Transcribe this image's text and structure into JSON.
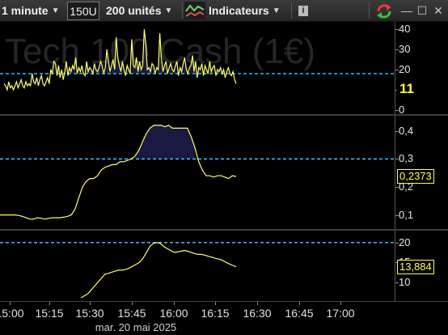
{
  "toolbar": {
    "interval": "1 minute",
    "units_box": "150U",
    "units_count": "200 unités",
    "indicators": "Indicateurs"
  },
  "instrument_title": "Tech 100 Cash (1€)",
  "panels": [
    {
      "id": "volume",
      "ticks": [
        "40",
        "30",
        "20",
        "10",
        "0"
      ],
      "tick_values": [
        40,
        30,
        20,
        10,
        0
      ],
      "ymin": 0,
      "ymax": 42,
      "level": 18,
      "current": "11",
      "current_value": 11
    },
    {
      "id": "osc1",
      "ticks": [
        "0,4",
        "0,3",
        "0,2",
        "0,1"
      ],
      "tick_values": [
        0.4,
        0.3,
        0.2,
        0.1
      ],
      "ymin": 0.07,
      "ymax": 0.44,
      "level": 0.3,
      "current": "0,2373",
      "current_value": 0.2373
    },
    {
      "id": "osc2",
      "ticks": [
        "20",
        "15",
        "10"
      ],
      "tick_values": [
        20,
        15,
        10
      ],
      "ymin": 6,
      "ymax": 22,
      "level": 20,
      "current": "13,884",
      "current_value": 13.884
    }
  ],
  "x_axis": {
    "labels": [
      "15:00",
      "15:15",
      "15:30",
      "15:45",
      "16:00",
      "16:15",
      "16:30",
      "16:45",
      "17:00"
    ],
    "date": "mar. 20 mai 2025"
  },
  "colors": {
    "line": "#ffff66",
    "level": "#3fb6ff",
    "fill": "#1c1c4a",
    "badge": "#ffff55"
  },
  "chart_data": [
    {
      "type": "line",
      "title": "",
      "series": [
        {
          "values": [
            13,
            12,
            10,
            14,
            11,
            12,
            10,
            12,
            14,
            11,
            13,
            15,
            12,
            11,
            14,
            12,
            13,
            12,
            18,
            14,
            13,
            16,
            12,
            15,
            17,
            13,
            12,
            14,
            16,
            13,
            20,
            18,
            24,
            23,
            17,
            22,
            16,
            20,
            15,
            19,
            24,
            17,
            21,
            19,
            22,
            20,
            26,
            18,
            21,
            19,
            22,
            18,
            17,
            24,
            19,
            21,
            20,
            18,
            23,
            20,
            19,
            21,
            24,
            22,
            18,
            21,
            30,
            24,
            19,
            22,
            25,
            20,
            36,
            26,
            22,
            19,
            24,
            20,
            17,
            22,
            20,
            18,
            35,
            22,
            21,
            26,
            19,
            24,
            20,
            22,
            40,
            33,
            20,
            21,
            19,
            23,
            22,
            18,
            21,
            20,
            38,
            26,
            19,
            22,
            24,
            18,
            21,
            23,
            20,
            19,
            22,
            24,
            17,
            21,
            19,
            23,
            26,
            20,
            18,
            21,
            22,
            27,
            19,
            24,
            16,
            21,
            20,
            23,
            17,
            22,
            20,
            18,
            24,
            19,
            21,
            22,
            17,
            20,
            19,
            21,
            18,
            20,
            16,
            19,
            21,
            18,
            17,
            19,
            15,
            13
          ]
        }
      ]
    },
    {
      "type": "line",
      "title": "",
      "series": [
        {
          "values": [
            0.1,
            0.1,
            0.1,
            0.1,
            0.1,
            0.098,
            0.095,
            0.09,
            0.085,
            0.085,
            0.09,
            0.088,
            0.085,
            0.088,
            0.09,
            0.09,
            0.09,
            0.092,
            0.095,
            0.1,
            0.12,
            0.16,
            0.2,
            0.22,
            0.23,
            0.23,
            0.24,
            0.26,
            0.27,
            0.275,
            0.28,
            0.28,
            0.29,
            0.29,
            0.295,
            0.3,
            0.31,
            0.33,
            0.36,
            0.39,
            0.41,
            0.42,
            0.42,
            0.42,
            0.415,
            0.42,
            0.41,
            0.41,
            0.41,
            0.41,
            0.41,
            0.38,
            0.34,
            0.29,
            0.26,
            0.24,
            0.24,
            0.235,
            0.24,
            0.24,
            0.235,
            0.23,
            0.24,
            0.2373
          ]
        }
      ]
    },
    {
      "type": "line",
      "title": "",
      "series": [
        {
          "values": [
            6,
            6.5,
            7,
            8,
            9,
            10,
            11,
            12,
            12.2,
            12.5,
            12.8,
            13,
            13,
            13.2,
            13.5,
            14,
            14.5,
            15,
            16,
            17.5,
            19,
            19.8,
            20,
            19.8,
            19,
            18.5,
            18,
            17.5,
            17.6,
            17.8,
            18,
            17.8,
            17.5,
            17.2,
            17,
            17,
            16.8,
            16.5,
            16.3,
            16,
            15.8,
            15.5,
            15,
            14.6,
            14.2,
            13.884
          ]
        }
      ]
    }
  ]
}
